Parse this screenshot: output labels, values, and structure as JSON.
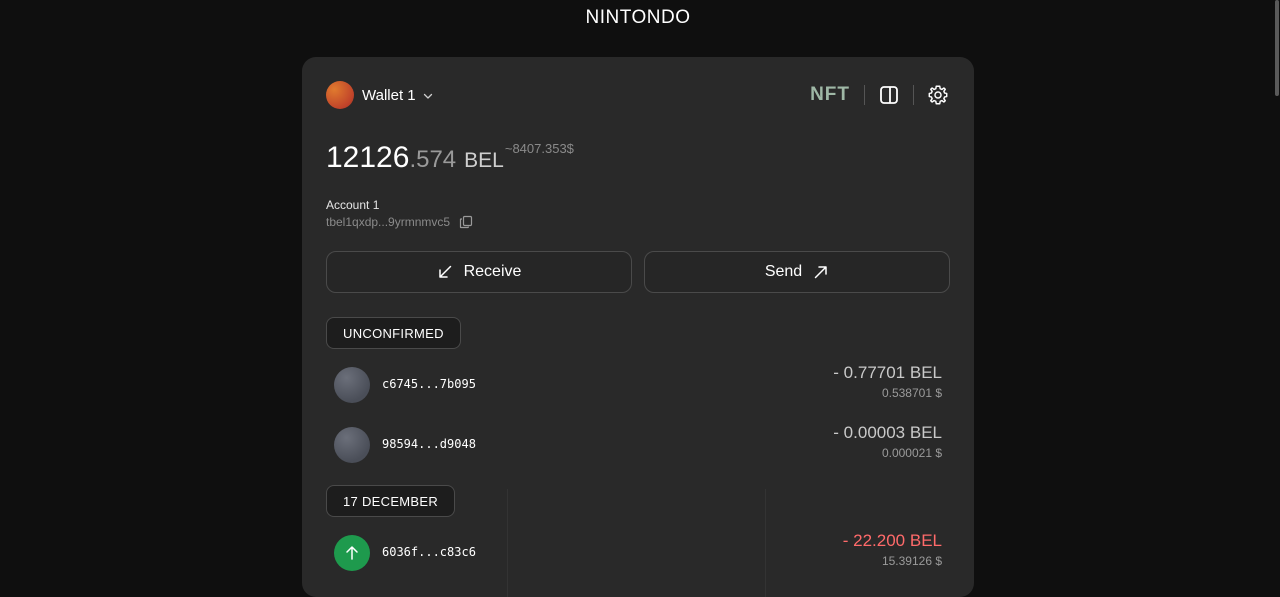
{
  "app": {
    "title": "NINTONDO"
  },
  "header": {
    "wallet_name": "Wallet 1",
    "nft_label": "NFT"
  },
  "balance": {
    "integer": "12126",
    "decimal": ".574",
    "unit": "BEL",
    "usd": "~8407.353$"
  },
  "account": {
    "name": "Account 1",
    "address": "tbel1qxdp...9yrmnmvc5"
  },
  "actions": {
    "receive_label": "Receive",
    "send_label": "Send"
  },
  "sections": {
    "unconfirmed_label": "UNCONFIRMED",
    "date_label": "17 DECEMBER"
  },
  "transactions": [
    {
      "hash": "c6745...7b095",
      "amount": "- 0.77701 BEL",
      "usd": "0.538701 $",
      "status": "pending"
    },
    {
      "hash": "98594...d9048",
      "amount": "- 0.00003 BEL",
      "usd": "0.000021 $",
      "status": "pending"
    },
    {
      "hash": "6036f...c83c6",
      "amount": "- 22.200 BEL",
      "usd": "15.39126 $",
      "status": "sent"
    }
  ],
  "colors": {
    "background": "#0f0f0f",
    "card": "#292929",
    "nft_accent": "#9fb8a6",
    "sent_icon": "#1e9a4d",
    "negative_amount": "#ff6a6a"
  },
  "icons": {
    "wallet_dropdown": "chevron-down-icon",
    "sidebar_toggle": "panel-icon",
    "settings": "gear-icon",
    "copy": "copy-icon",
    "receive": "arrow-down-left-icon",
    "send": "arrow-up-right-icon",
    "sent_tx": "arrow-up-icon"
  }
}
